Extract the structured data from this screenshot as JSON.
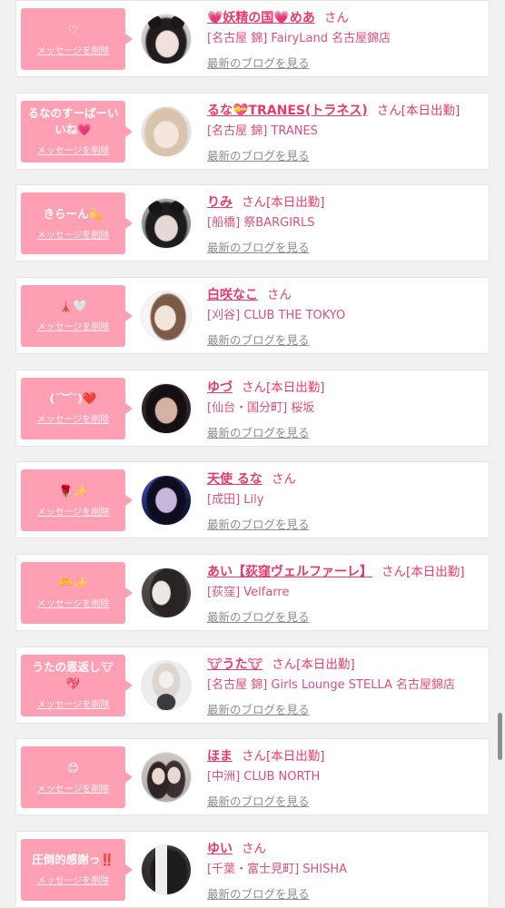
{
  "colors": {
    "page_bg": "#f1f1f1",
    "bubble_pink": "#ff9fb3",
    "name_pink": "#e33b6d",
    "location_pink": "#d9507f",
    "link_gray": "#8c8c8c"
  },
  "messages": [
    {
      "message": "♡",
      "delete_label": "メッセージを削除",
      "name": "💗妖精の国💗めあ",
      "honorific": "さん",
      "status": "",
      "location": "[名古屋 錦] FairyLand 名古屋錦店",
      "blog_link": "最新のブログを見る"
    },
    {
      "message": "るなのすーぱーいいね💗",
      "delete_label": "メッセージを削除",
      "name": "るな💝TRANES(トラネス)",
      "honorific": "さん",
      "status": "[本日出勤]",
      "location": "[名古屋 錦] TRANES",
      "blog_link": "最新のブログを見る"
    },
    {
      "message": "きらーん💫",
      "delete_label": "メッセージを削除",
      "name": "りみ",
      "honorific": "さん",
      "status": "[本日出勤]",
      "location": "[船橋] 祭BARGIRLS",
      "blog_link": "最新のブログを見る"
    },
    {
      "message": "🗼🤍",
      "delete_label": "メッセージを削除",
      "name": "白咲なこ",
      "honorific": "さん",
      "status": "",
      "location": "[刈谷] CLUB THE TOKYO",
      "blog_link": "最新のブログを見る"
    },
    {
      "message": "(˘︶˘)❤️",
      "delete_label": "メッセージを削除",
      "name": "ゆづ",
      "honorific": "さん",
      "status": "[本日出勤]",
      "location": "[仙台・国分町] 桜坂",
      "blog_link": "最新のブログを見る"
    },
    {
      "message": "🌹✨",
      "delete_label": "メッセージを削除",
      "name": "天使 るな",
      "honorific": "さん",
      "status": "",
      "location": "[成田] Lily",
      "blog_link": "最新のブログを見る"
    },
    {
      "message": "🫶✨",
      "delete_label": "メッセージを削除",
      "name": "あい【荻窪ヴェルファーレ】",
      "honorific": "さん",
      "status": "[本日出勤]",
      "location": "[荻窪] Velfarre",
      "blog_link": "最新のブログを見る"
    },
    {
      "message": "うたの恩返し🐮💖",
      "delete_label": "メッセージを削除",
      "name": "🐮うた🐮",
      "honorific": "さん",
      "status": "[本日出勤]",
      "location": "[名古屋 錦] Girls Lounge STELLA 名古屋錦店",
      "blog_link": "最新のブログを見る"
    },
    {
      "message": "😊",
      "delete_label": "メッセージを削除",
      "name": "ほま",
      "honorific": "さん",
      "status": "[本日出勤]",
      "location": "[中洲] CLUB NORTH",
      "blog_link": "最新のブログを見る"
    },
    {
      "message": "圧倒的感謝っ‼️",
      "delete_label": "メッセージを削除",
      "name": "ゆい",
      "honorific": "さん",
      "status": "",
      "location": "[千葉・富士見町] SHISHA",
      "blog_link": "最新のブログを見る"
    }
  ]
}
